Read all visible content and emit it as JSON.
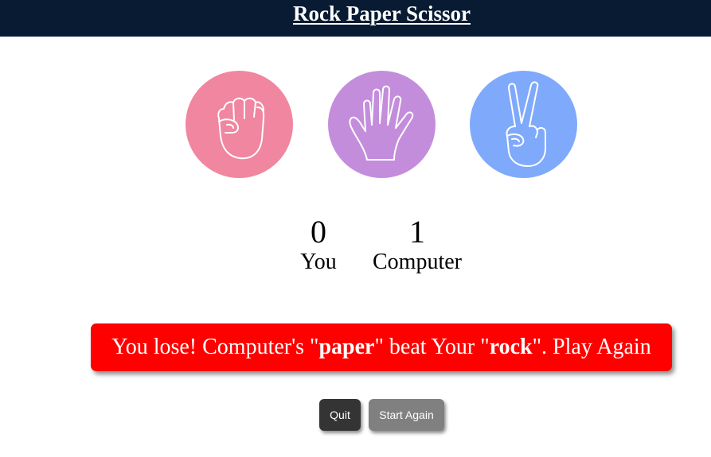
{
  "header": {
    "title": "Rock Paper Scissor"
  },
  "choices": [
    {
      "name": "rock",
      "icon": "fist-icon",
      "color": "#f0869f"
    },
    {
      "name": "paper",
      "icon": "open-hand-icon",
      "color": "#c38ddc"
    },
    {
      "name": "scissor",
      "icon": "peace-hand-icon",
      "color": "#7fa9fb"
    }
  ],
  "scoreboard": {
    "you_score": "0",
    "you_label": "You",
    "computer_score": "1",
    "computer_label": "Computer"
  },
  "result": {
    "prefix": "You lose! Computer's \"",
    "computer_choice": "paper",
    "middle": "\" beat Your \"",
    "user_choice": "rock",
    "suffix": "\". Play Again",
    "background": "#ff0000"
  },
  "buttons": {
    "quit_label": "Quit",
    "start_again_label": "Start Again"
  },
  "colors": {
    "header_bg": "#081b33",
    "quit_bg": "#343434",
    "start_again_bg": "#808080"
  }
}
